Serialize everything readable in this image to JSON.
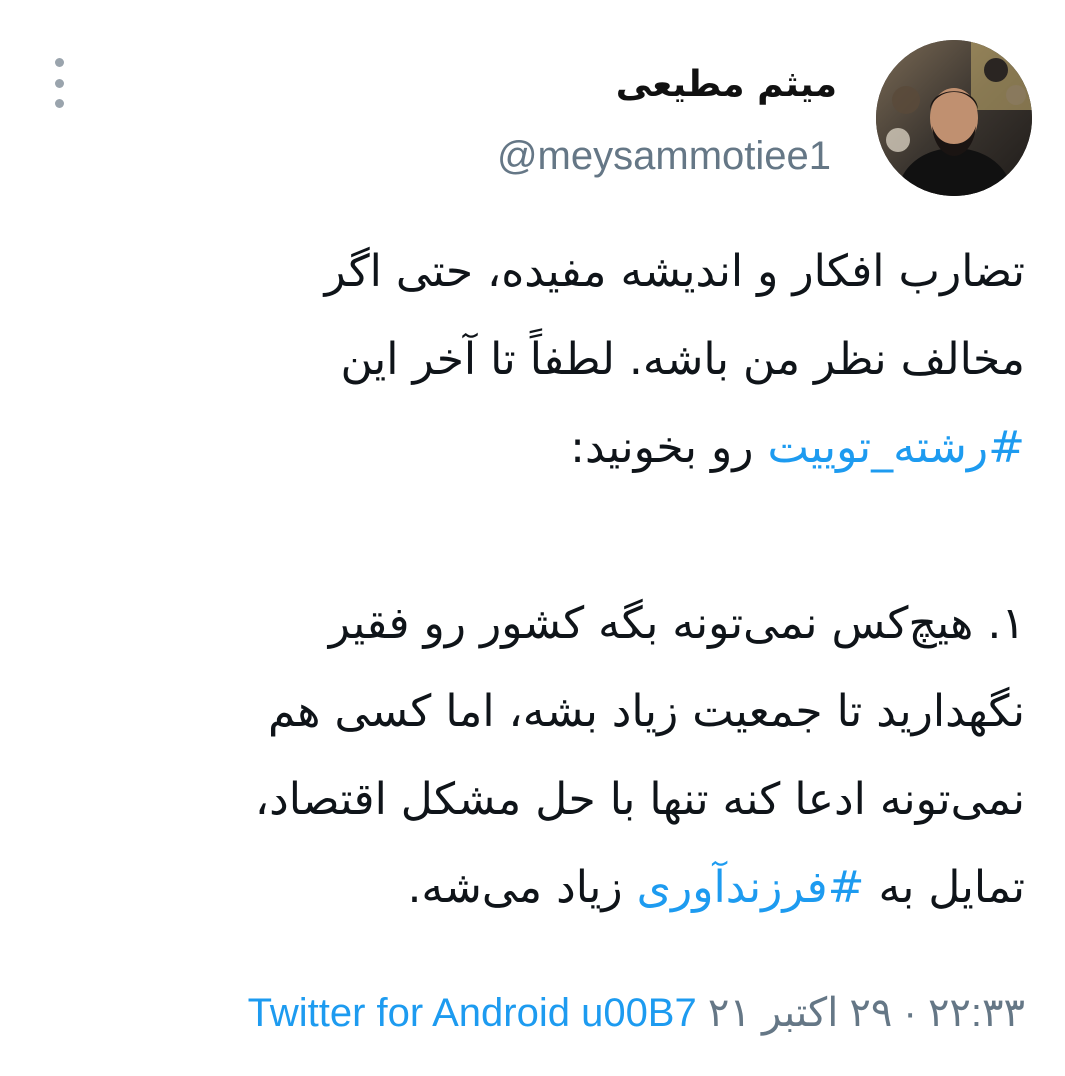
{
  "author": {
    "display_name": "میثم مطیعی",
    "handle": "@meysammotiee1",
    "avatar_icon": "profile-photo"
  },
  "tweet": {
    "paragraph1": {
      "line1": "تضارب افکار و اندیشه مفیده، حتی اگر",
      "line2": "مخالف نظر من باشه. لطفاً تا آخر این",
      "line3_hashtag": "#رشته_توییت",
      "line3_rest": " رو بخونید:"
    },
    "paragraph2": {
      "line1": "۱. هیچ‌کس نمی‌تونه بگه کشور رو فقیر",
      "line2": "نگهدارید تا جمعیت زیاد بشه، اما کسی هم",
      "line3": "نمی‌تونه ادعا کنه تنها با حل مشکل اقتصاد،",
      "line4_pre": "تمایل به ",
      "line4_hashtag": "#فرزندآوری",
      "line4_post": " زیاد می‌شه."
    }
  },
  "footer": {
    "time": "۲۲:۳۳",
    "separator1": " · ",
    "date": "۲۹ اکتبر ۲۱",
    "source": "Twitter for Android u00B7"
  },
  "colors": {
    "hashtag": "#1d9bf0",
    "secondary_text": "#657786",
    "primary_text": "#0f1419"
  }
}
